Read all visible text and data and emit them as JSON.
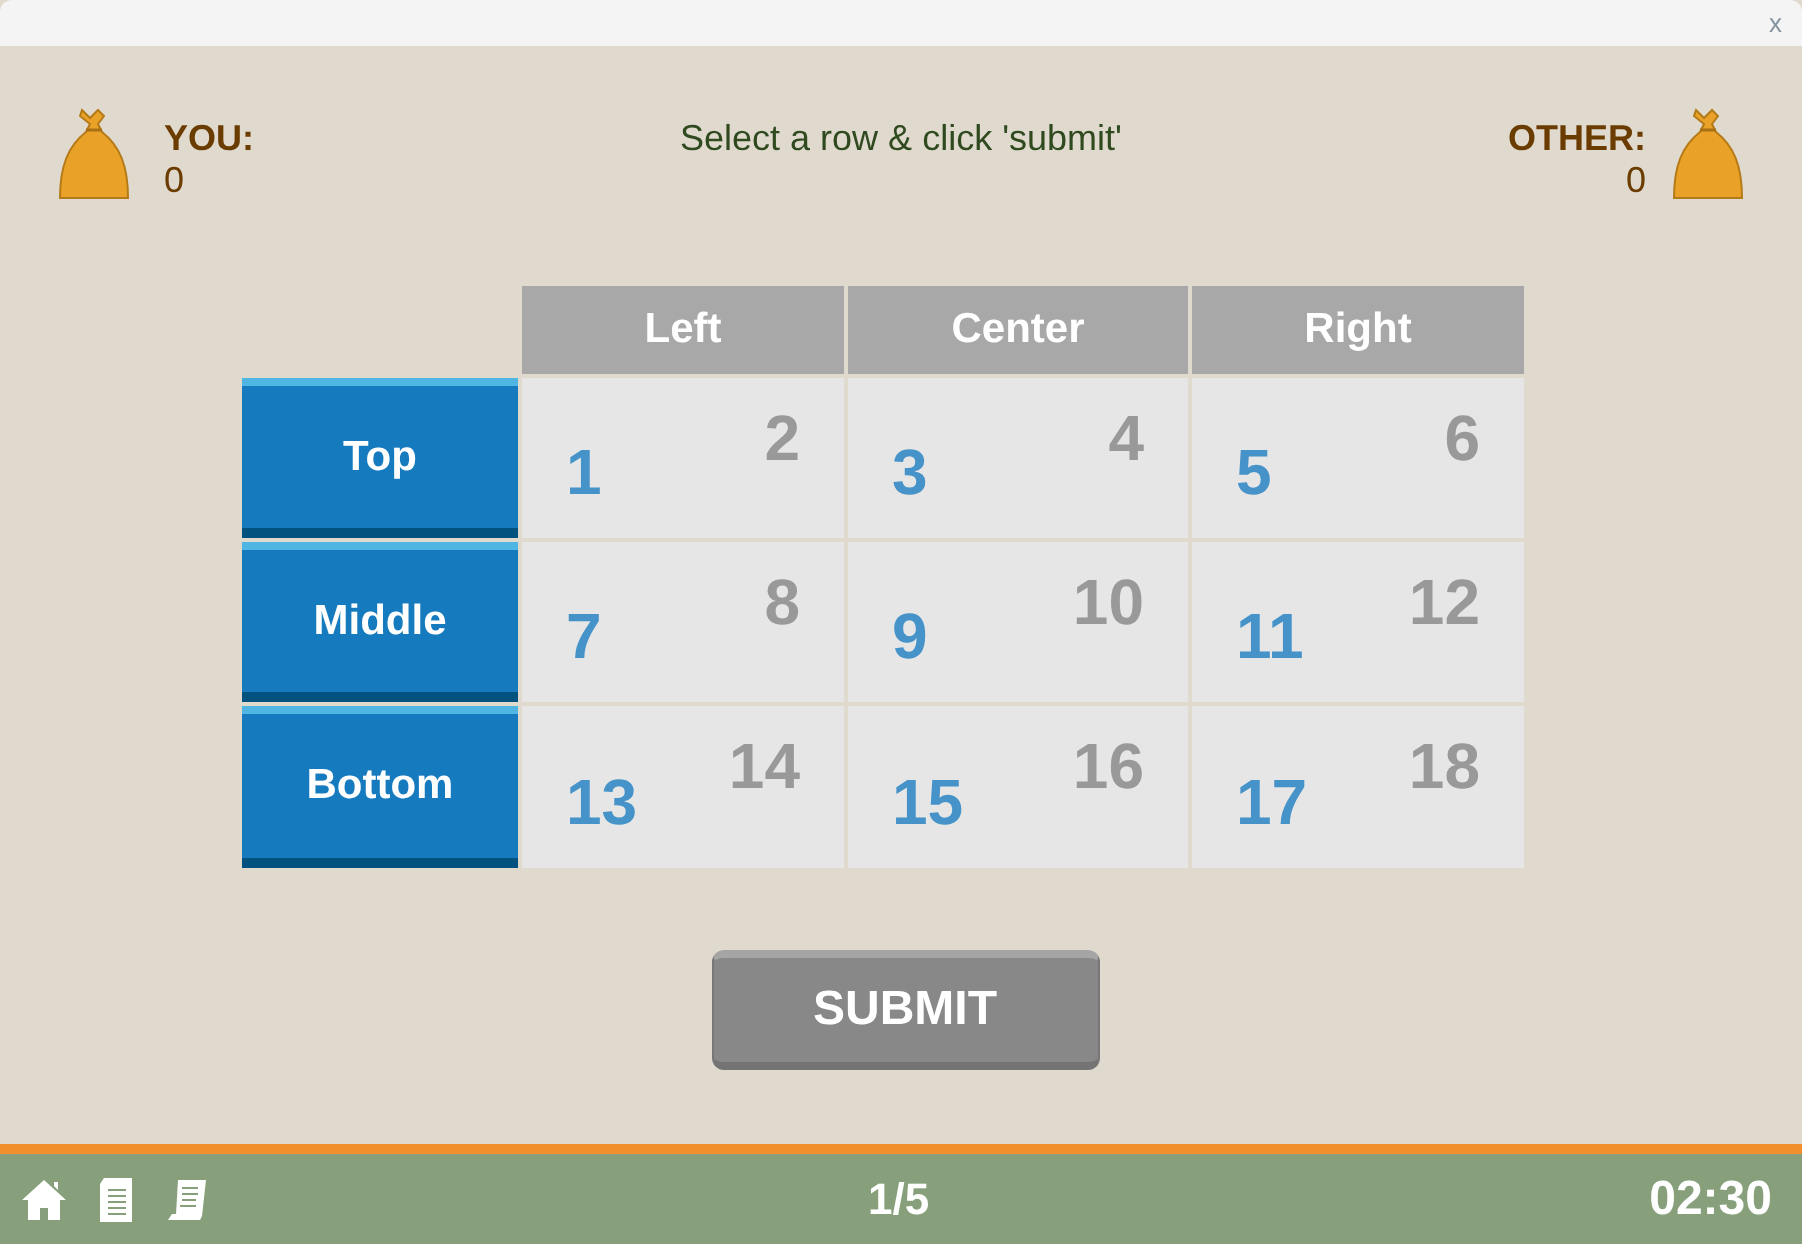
{
  "window": {
    "close": "x"
  },
  "players": [
    {
      "label": "YOU:",
      "score": "0"
    },
    {
      "label": "OTHER:",
      "score": "0"
    }
  ],
  "instruction": "Select a row & click 'submit'",
  "columns": [
    "Left",
    "Center",
    "Right"
  ],
  "rows": [
    {
      "label": "Top",
      "cells": [
        [
          "1",
          "2"
        ],
        [
          "3",
          "4"
        ],
        [
          "5",
          "6"
        ]
      ]
    },
    {
      "label": "Middle",
      "cells": [
        [
          "7",
          "8"
        ],
        [
          "9",
          "10"
        ],
        [
          "11",
          "12"
        ]
      ]
    },
    {
      "label": "Bottom",
      "cells": [
        [
          "13",
          "14"
        ],
        [
          "15",
          "16"
        ],
        [
          "17",
          "18"
        ]
      ]
    }
  ],
  "submit": "SUBMIT",
  "footer": {
    "round": "1/5",
    "timer": "02:30"
  }
}
